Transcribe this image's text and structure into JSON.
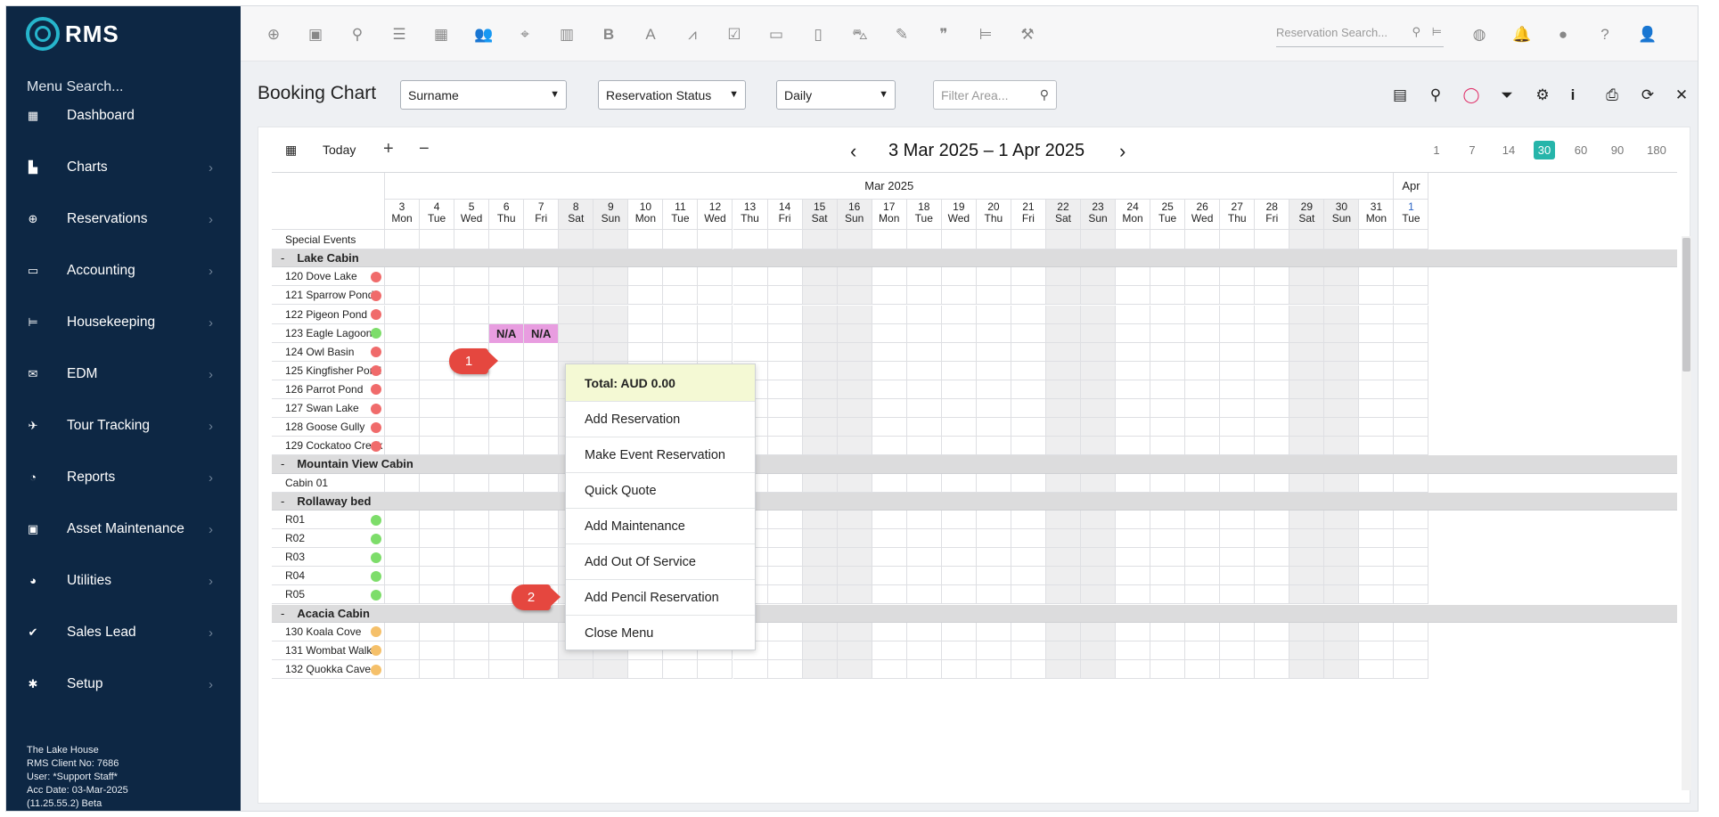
{
  "sidebar": {
    "logo_text": "RMS",
    "menu_search": "Menu Search...",
    "items": [
      {
        "label": "Dashboard",
        "icon": "dashboard-icon",
        "chevron": false
      },
      {
        "label": "Charts",
        "icon": "charts-icon",
        "chevron": true
      },
      {
        "label": "Reservations",
        "icon": "reservations-icon",
        "chevron": true
      },
      {
        "label": "Accounting",
        "icon": "accounting-icon",
        "chevron": true
      },
      {
        "label": "Housekeeping",
        "icon": "bed-icon",
        "chevron": true
      },
      {
        "label": "EDM",
        "icon": "mail-icon",
        "chevron": true
      },
      {
        "label": "Tour Tracking",
        "icon": "plane-icon",
        "chevron": true
      },
      {
        "label": "Reports",
        "icon": "pie-icon",
        "chevron": true
      },
      {
        "label": "Asset Maintenance",
        "icon": "toolbox-icon",
        "chevron": true
      },
      {
        "label": "Utilities",
        "icon": "gauge-icon",
        "chevron": true
      },
      {
        "label": "Sales Lead",
        "icon": "check-circle-icon",
        "chevron": true
      },
      {
        "label": "Setup",
        "icon": "gear-icon",
        "chevron": true
      }
    ],
    "footer": {
      "property": "The Lake House",
      "client_no": "RMS Client No: 7686",
      "user": "User: *Support Staff*",
      "acc_date": "Acc Date: 03-Mar-2025",
      "version": "(11.25.55.2) Beta"
    }
  },
  "topbar": {
    "search_placeholder": "Reservation Search..."
  },
  "header": {
    "title": "Booking Chart",
    "sort_select": "Surname",
    "status_select": "Reservation Status",
    "view_select": "Daily",
    "filter_placeholder": "Filter Area..."
  },
  "nav": {
    "today": "Today",
    "zoom_in": "+",
    "zoom_out": "−",
    "range": "3 Mar 2025 – 1 Apr 2025",
    "spans": [
      "1",
      "7",
      "14",
      "30",
      "60",
      "90",
      "180"
    ],
    "active_span": "30"
  },
  "grid": {
    "months": [
      {
        "label": "Mar 2025"
      },
      {
        "label": "Apr"
      }
    ],
    "days": [
      {
        "n": "3",
        "d": "Mon"
      },
      {
        "n": "4",
        "d": "Tue"
      },
      {
        "n": "5",
        "d": "Wed"
      },
      {
        "n": "6",
        "d": "Thu"
      },
      {
        "n": "7",
        "d": "Fri"
      },
      {
        "n": "8",
        "d": "Sat"
      },
      {
        "n": "9",
        "d": "Sun"
      },
      {
        "n": "10",
        "d": "Mon"
      },
      {
        "n": "11",
        "d": "Tue"
      },
      {
        "n": "12",
        "d": "Wed"
      },
      {
        "n": "13",
        "d": "Thu"
      },
      {
        "n": "14",
        "d": "Fri"
      },
      {
        "n": "15",
        "d": "Sat"
      },
      {
        "n": "16",
        "d": "Sun"
      },
      {
        "n": "17",
        "d": "Mon"
      },
      {
        "n": "18",
        "d": "Tue"
      },
      {
        "n": "19",
        "d": "Wed"
      },
      {
        "n": "20",
        "d": "Thu"
      },
      {
        "n": "21",
        "d": "Fri"
      },
      {
        "n": "22",
        "d": "Sat"
      },
      {
        "n": "23",
        "d": "Sun"
      },
      {
        "n": "24",
        "d": "Mon"
      },
      {
        "n": "25",
        "d": "Tue"
      },
      {
        "n": "26",
        "d": "Wed"
      },
      {
        "n": "27",
        "d": "Thu"
      },
      {
        "n": "28",
        "d": "Fri"
      },
      {
        "n": "29",
        "d": "Sat"
      },
      {
        "n": "30",
        "d": "Sun"
      },
      {
        "n": "31",
        "d": "Mon"
      },
      {
        "n": "1",
        "d": "Tue"
      }
    ],
    "special_events": "Special Events",
    "rows": [
      {
        "type": "group",
        "label": "Lake Cabin"
      },
      {
        "type": "room",
        "label": "120 Dove Lake",
        "status": "#f06b6b"
      },
      {
        "type": "room",
        "label": "121 Sparrow Pond",
        "status": "#f06b6b"
      },
      {
        "type": "room",
        "label": "122 Pigeon Pond",
        "status": "#f06b6b"
      },
      {
        "type": "room",
        "label": "123 Eagle Lagoon",
        "status": "#7ddd6a"
      },
      {
        "type": "room",
        "label": "124 Owl Basin",
        "status": "#f06b6b"
      },
      {
        "type": "room",
        "label": "125 Kingfisher Pond",
        "status": "#f06b6b"
      },
      {
        "type": "room",
        "label": "126 Parrot Pond",
        "status": "#f06b6b"
      },
      {
        "type": "room",
        "label": "127 Swan Lake",
        "status": "#f06b6b"
      },
      {
        "type": "room",
        "label": "128 Goose Gully",
        "status": "#f06b6b"
      },
      {
        "type": "room",
        "label": "129 Cockatoo Creek",
        "status": "#f06b6b"
      },
      {
        "type": "group",
        "label": "Mountain View Cabin"
      },
      {
        "type": "room",
        "label": "Cabin 01",
        "status": null
      },
      {
        "type": "group",
        "label": "Rollaway bed"
      },
      {
        "type": "room",
        "label": "R01",
        "status": "#7ddd6a"
      },
      {
        "type": "room",
        "label": "R02",
        "status": "#7ddd6a"
      },
      {
        "type": "room",
        "label": "R03",
        "status": "#7ddd6a"
      },
      {
        "type": "room",
        "label": "R04",
        "status": "#7ddd6a"
      },
      {
        "type": "room",
        "label": "R05",
        "status": "#7ddd6a"
      },
      {
        "type": "group",
        "label": "Acacia Cabin"
      },
      {
        "type": "room",
        "label": "130 Koala Cove",
        "status": "#f5c06a"
      },
      {
        "type": "room",
        "label": "131 Wombat Walk",
        "status": "#f5c06a"
      },
      {
        "type": "room",
        "label": "132 Quokka Cave",
        "status": "#f5c06a"
      }
    ],
    "bookings": [
      {
        "room": "123 Eagle Lagoon",
        "day": "6",
        "label": "N/A"
      },
      {
        "room": "123 Eagle Lagoon",
        "day": "7",
        "label": "N/A"
      }
    ]
  },
  "context_menu": {
    "total": "Total: AUD 0.00",
    "items": [
      "Add Reservation",
      "Make Event Reservation",
      "Quick Quote",
      "Add Maintenance",
      "Add Out Of Service",
      "Add Pencil Reservation",
      "Close Menu"
    ]
  },
  "callouts": [
    "1",
    "2"
  ]
}
